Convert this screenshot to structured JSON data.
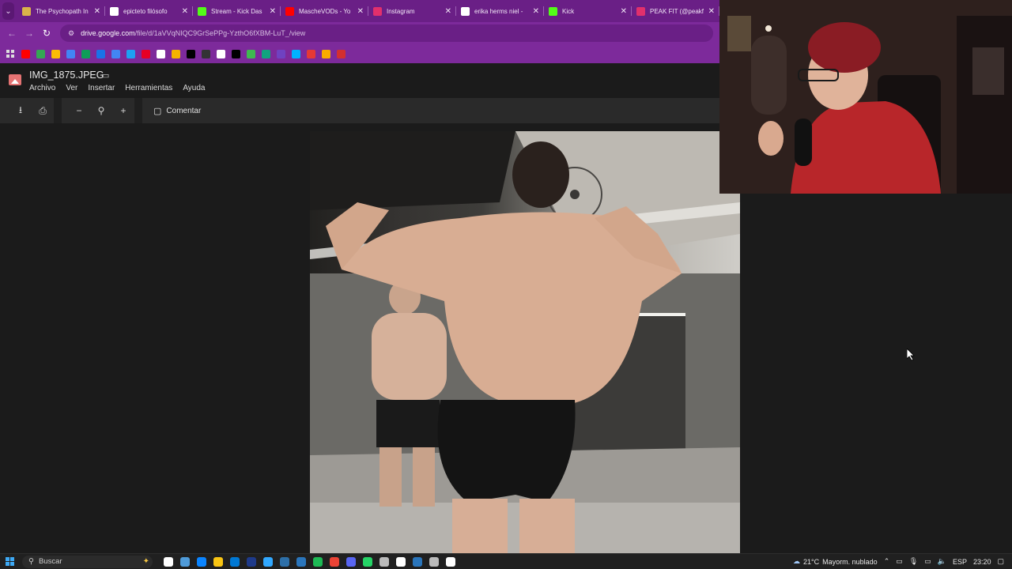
{
  "tabs": [
    {
      "title": "The Psychopath In",
      "favicon_color": "#d9b24a",
      "close": "✕"
    },
    {
      "title": "epicteto filósofo",
      "favicon_color": "#ffffff",
      "close": "✕"
    },
    {
      "title": "Stream - Kick Das",
      "favicon_color": "#53fc18",
      "close": "✕"
    },
    {
      "title": "MascheVODs - Yo",
      "favicon_color": "#ff0000",
      "close": "✕"
    },
    {
      "title": "Instagram",
      "favicon_color": "#e1306c",
      "close": "✕"
    },
    {
      "title": "erika herms niel -",
      "favicon_color": "#ffffff",
      "close": "✕"
    },
    {
      "title": "Kick",
      "favicon_color": "#53fc18",
      "close": "✕"
    },
    {
      "title": "PEAK FIT (@peakf",
      "favicon_color": "#e1306c",
      "close": "✕"
    }
  ],
  "address": {
    "host": "drive.google.com",
    "path": "/file/d/1aVVqNIQC9GrSePPg-YzthO6fXBM-LuT_/view"
  },
  "bookmark_colors": [
    "#ff0000",
    "#34a853",
    "#fbbc04",
    "#4285f4",
    "#0f9d58",
    "#1a73e8",
    "#4285f4",
    "#1da1f2",
    "#e60023",
    "#ffffff",
    "#f4b400",
    "#000000",
    "#333333",
    "#ffffff",
    "#000000",
    "#3fb950",
    "#10a37f",
    "#6f42c1",
    "#00b2ff",
    "#e53935",
    "#f9ab00",
    "#d32f2f"
  ],
  "drive": {
    "file_name": "IMG_1875.JPEG",
    "menus": [
      "Archivo",
      "Ver",
      "Insertar",
      "Herramientas",
      "Ayuda"
    ],
    "comment_label": "Comentar"
  },
  "taskbar": {
    "search_placeholder": "Buscar",
    "app_colors": [
      "#ffffff",
      "#4f9bd9",
      "#0a84ff",
      "#f9c513",
      "#0078d4",
      "#1e3a8a",
      "#31a8ff",
      "#2d6fa8",
      "#2a75bb",
      "#1db954",
      "#ea4335",
      "#5865f2",
      "#25d366",
      "#bbbbbb",
      "#ffffff",
      "#2a75bb",
      "#bbbbbb",
      "#ffffff"
    ],
    "temperature": "21°C",
    "weather": "Mayorm. nublado",
    "lang": "ESP",
    "time": "23:20"
  }
}
